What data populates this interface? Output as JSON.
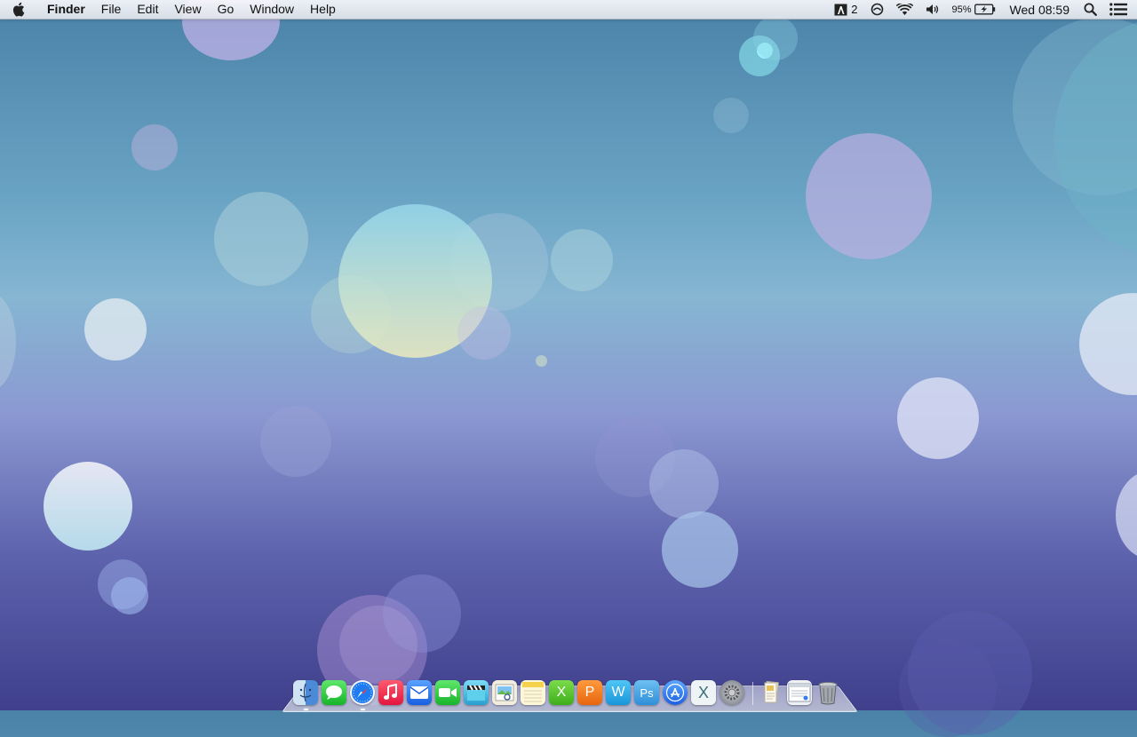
{
  "menubar": {
    "app_name": "Finder",
    "menus": [
      "File",
      "Edit",
      "View",
      "Go",
      "Window",
      "Help"
    ],
    "status": {
      "adobe_count": "2",
      "battery_percent": "95%",
      "clock": "Wed 08:59"
    }
  },
  "dock": {
    "apps": [
      {
        "name": "finder",
        "icon": "finder-icon",
        "glyph": "",
        "color": "#6f9ed8"
      },
      {
        "name": "messages",
        "icon": "messages-icon",
        "glyph": "",
        "color": "#29c93a"
      },
      {
        "name": "safari",
        "icon": "safari-icon",
        "glyph": "",
        "color": "#1d7cf2"
      },
      {
        "name": "music",
        "icon": "music-icon",
        "glyph": "",
        "color": "#f0224e"
      },
      {
        "name": "mail",
        "icon": "mail-icon",
        "glyph": "",
        "color": "#2c74ef"
      },
      {
        "name": "facetime",
        "icon": "facetime-icon",
        "glyph": "",
        "color": "#26c83a"
      },
      {
        "name": "final-cut",
        "icon": "clapper-icon",
        "glyph": "",
        "color": "#37b8d8"
      },
      {
        "name": "preview",
        "icon": "preview-icon",
        "glyph": "",
        "color": "#e8e6c8"
      },
      {
        "name": "notes",
        "icon": "notes-icon",
        "glyph": "",
        "color": "#f6e26b"
      },
      {
        "name": "excel",
        "icon": "excel-icon",
        "glyph": "X",
        "color": "#53c22a"
      },
      {
        "name": "powerpoint",
        "icon": "powerpoint-icon",
        "glyph": "P",
        "color": "#f07a1f"
      },
      {
        "name": "word",
        "icon": "word-icon",
        "glyph": "W",
        "color": "#1fa6e8"
      },
      {
        "name": "photoshop",
        "icon": "photoshop-icon",
        "glyph": "Ps",
        "color": "#3b9fe0"
      },
      {
        "name": "app-store",
        "icon": "app-store-icon",
        "glyph": "",
        "color": "#2f7df0"
      },
      {
        "name": "os-x",
        "icon": "osx-icon",
        "glyph": "X",
        "color": "#e9eef2"
      },
      {
        "name": "system-preferences",
        "icon": "gear-icon",
        "glyph": "",
        "color": "#8b8f96"
      }
    ],
    "right_items": [
      {
        "name": "documents-stack",
        "icon": "stack-icon",
        "color": "#f1efe4"
      },
      {
        "name": "downloads-window",
        "icon": "window-icon",
        "color": "#eef2f6"
      },
      {
        "name": "trash",
        "icon": "trash-icon",
        "color": "#a2a7ad"
      }
    ]
  },
  "colors": {
    "menubar_bg": "#eef1f5",
    "wallpaper_top": "#4a82a8",
    "wallpaper_bottom": "#3f3f8c"
  }
}
